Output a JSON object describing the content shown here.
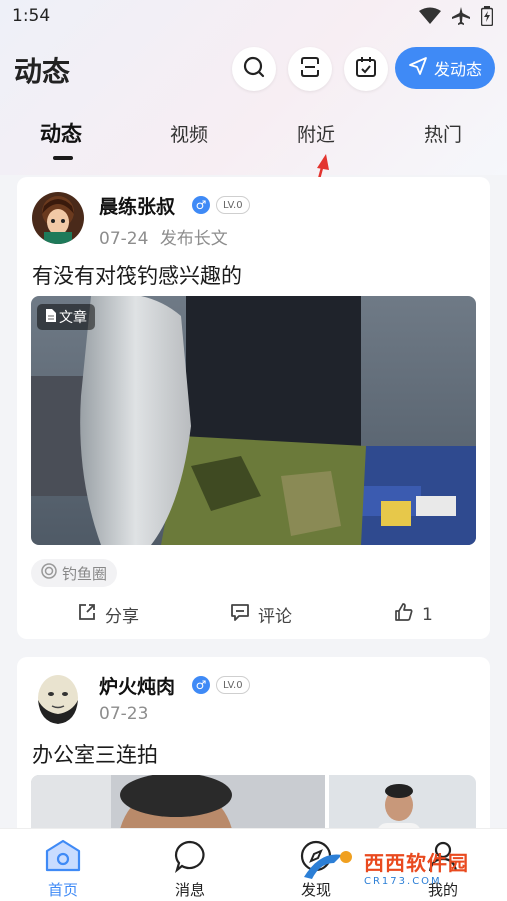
{
  "status_bar": {
    "time": "1:54"
  },
  "header": {
    "title": "动态",
    "post_label": "发动态"
  },
  "tabs": [
    {
      "label": "动态",
      "active": true
    },
    {
      "label": "视频",
      "active": false
    },
    {
      "label": "附近",
      "active": false
    },
    {
      "label": "热门",
      "active": false
    }
  ],
  "posts": [
    {
      "user_name": "晨练张叔",
      "level": "LV.0",
      "date": "07-24",
      "type_text": "发布长文",
      "title": "有没有对筏钓感兴趣的",
      "media_tag": "文章",
      "circle": "钓鱼圈",
      "share_label": "分享",
      "comment_label": "评论",
      "like_count": "1"
    },
    {
      "user_name": "炉火炖肉",
      "level": "LV.0",
      "date": "07-23",
      "title": "办公室三连拍"
    }
  ],
  "bottom_nav": [
    {
      "label": "首页",
      "active": true
    },
    {
      "label": "消息",
      "active": false
    },
    {
      "label": "发现",
      "active": false
    },
    {
      "label": "我的",
      "active": false
    }
  ],
  "watermark": {
    "title": "西西软件园",
    "url": "CR173.COM"
  },
  "colors": {
    "accent": "#3f8af6",
    "background": "#f3f4f7",
    "arrow": "#e3342f"
  }
}
